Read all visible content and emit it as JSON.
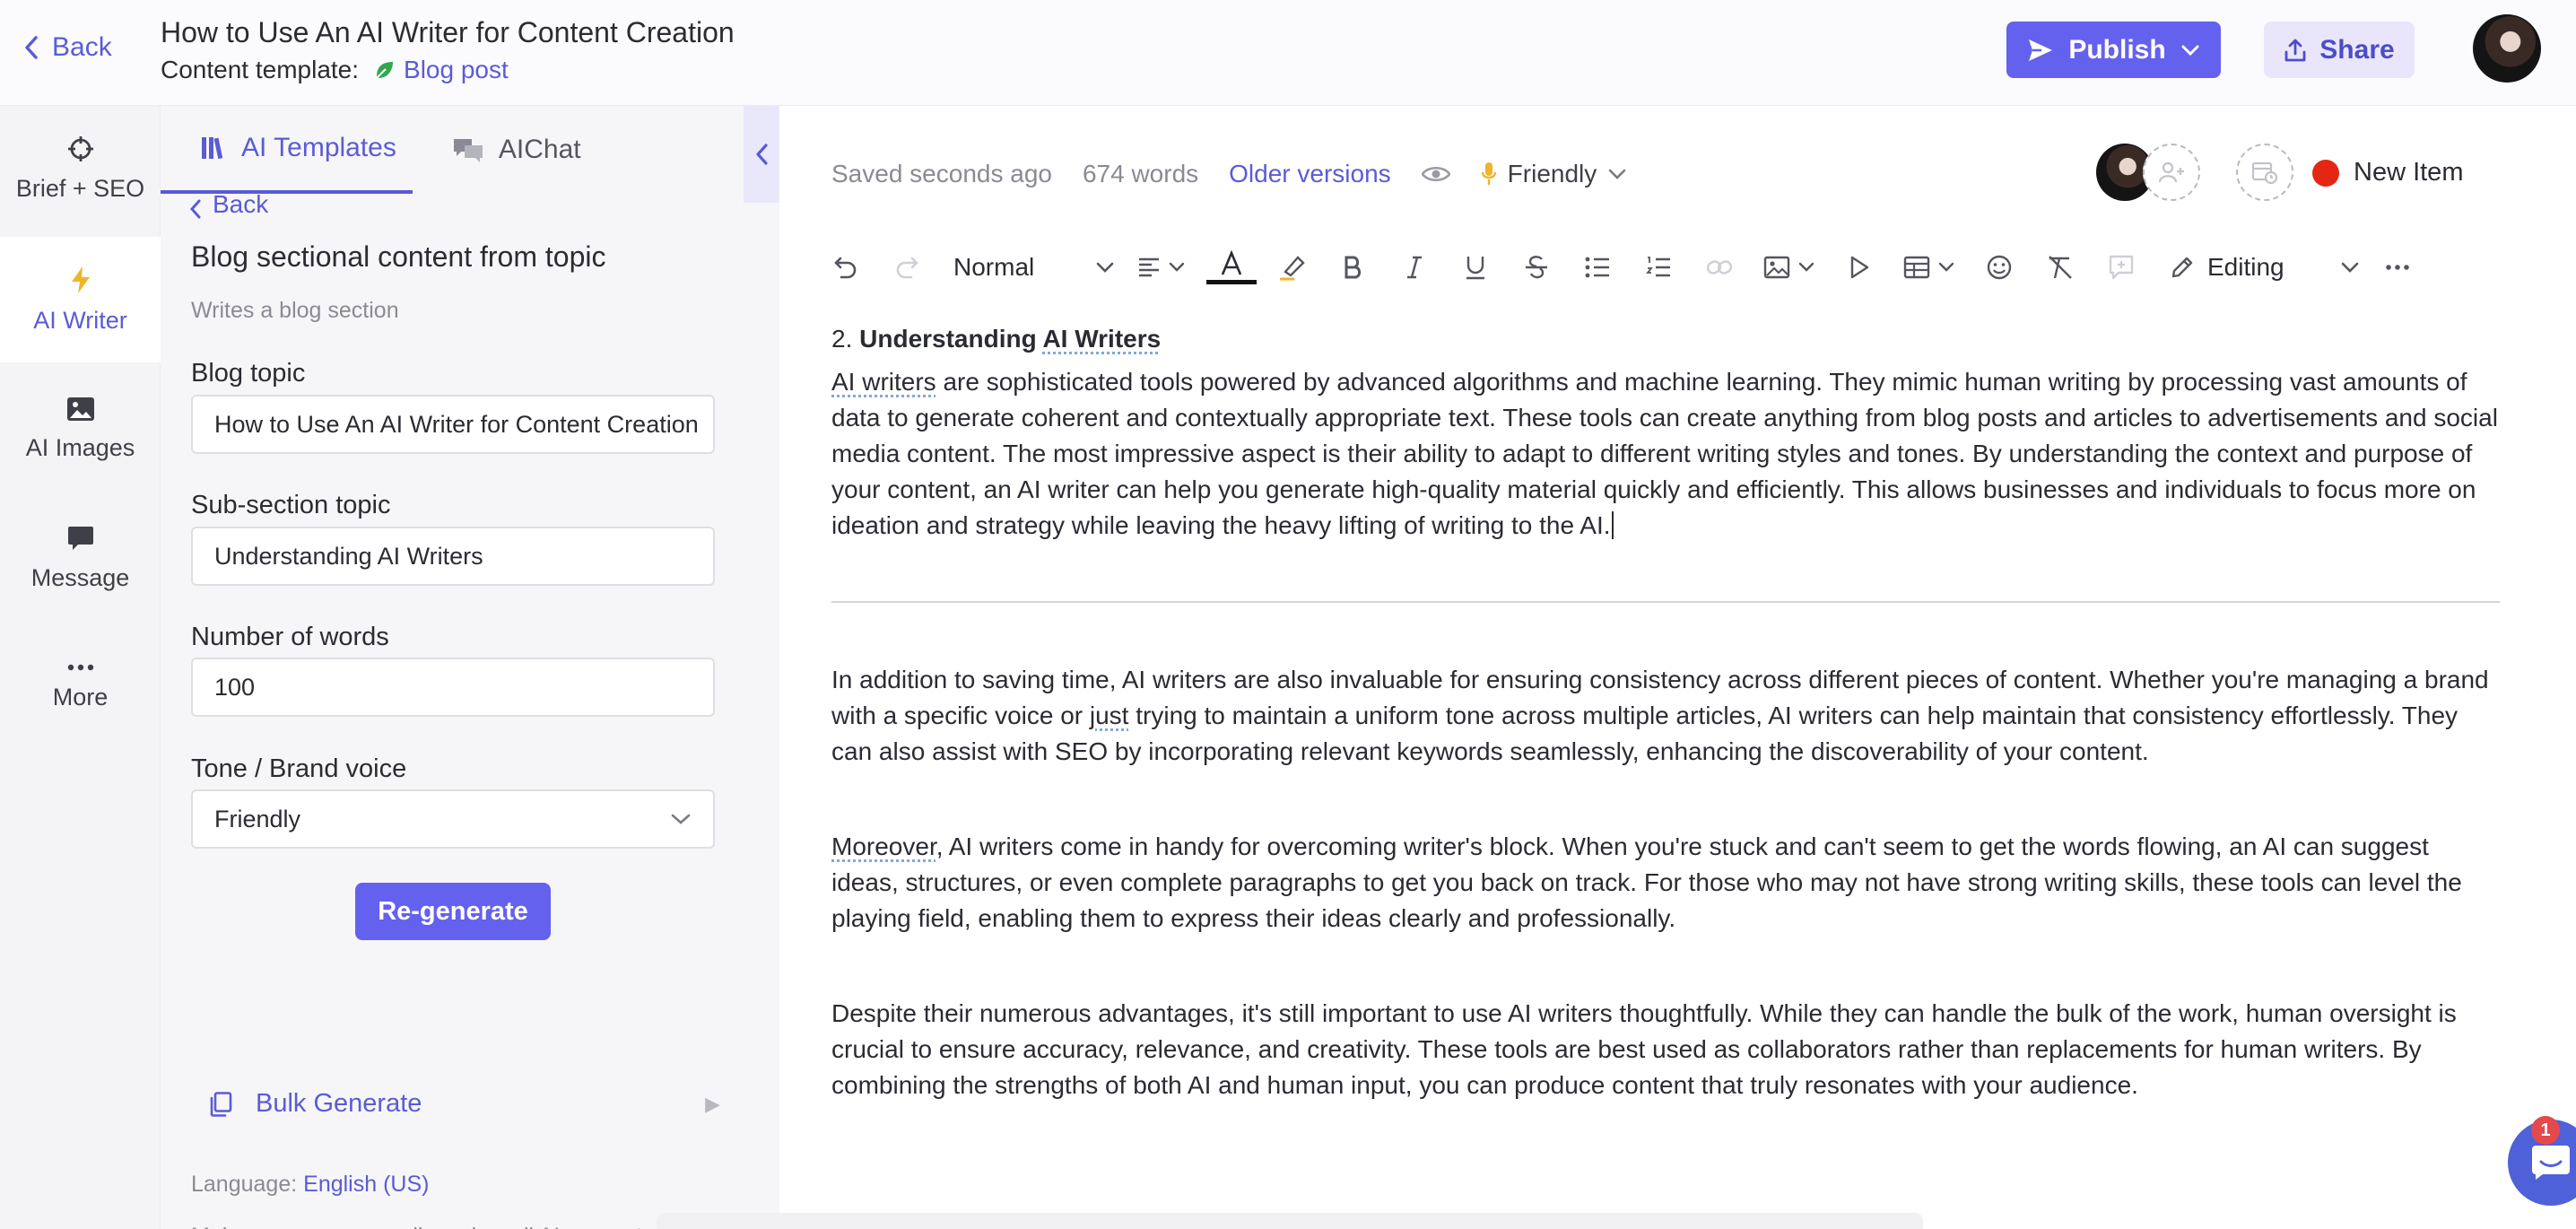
{
  "header": {
    "back_label": "Back",
    "title": "How to Use An AI Writer for Content Creation",
    "template_label": "Content template:",
    "template_value": "Blog post",
    "publish_label": "Publish",
    "share_label": "Share"
  },
  "rail": {
    "items": [
      {
        "label": "Brief + SEO",
        "icon": "crosshair-icon"
      },
      {
        "label": "AI Writer",
        "icon": "lightning-icon"
      },
      {
        "label": "AI Images",
        "icon": "image-icon"
      },
      {
        "label": "Message",
        "icon": "chat-bubble-icon"
      },
      {
        "label": "More",
        "icon": "dots-icon"
      }
    ]
  },
  "panel": {
    "tabs": [
      {
        "label": "AI Templates",
        "icon": "library-icon"
      },
      {
        "label": "AIChat",
        "icon": "chat-icon"
      }
    ],
    "back_label": "Back",
    "section_title": "Blog sectional content from topic",
    "section_subtitle": "Writes a blog section",
    "fields": {
      "blog_topic": {
        "label": "Blog topic",
        "value": "How to Use An AI Writer for Content Creation"
      },
      "subsection_topic": {
        "label": "Sub-section topic",
        "value": "Understanding AI Writers"
      },
      "num_words": {
        "label": "Number of words",
        "value": "100"
      },
      "tone": {
        "label": "Tone / Brand voice",
        "value": "Friendly"
      }
    },
    "regenerate_label": "Re-generate",
    "bulk_label": "Bulk Generate",
    "language_label": "Language:",
    "language_value": "English (US)",
    "disclaimer": "Make sure you manually review all AI generated text."
  },
  "editor": {
    "status": {
      "saved": "Saved seconds ago",
      "words": "674 words",
      "older_versions": "Older versions",
      "tone": "Friendly"
    },
    "new_item_label": "New Item",
    "toolbar": {
      "style_value": "Normal",
      "mode_value": "Editing"
    },
    "heading_number": "2.",
    "heading_text": "Understanding ",
    "heading_text_marked": "AI Writers",
    "p1_marked": "AI writers",
    "p1_rest": " are sophisticated tools powered by advanced algorithms and machine learning. They mimic human writing by processing vast amounts of data to generate coherent and contextually appropriate text. These tools can create anything from blog posts and articles to advertisements and social media content. The most impressive aspect is their ability to adapt to different writing styles and tones. By understanding the context and purpose of your content, an AI writer can help you generate high-quality material quickly and efficiently. This allows businesses and individuals to focus more on ideation and strategy while leaving the heavy lifting of writing to the AI.",
    "p2_a": "In addition to saving time, AI writers are also invaluable for ensuring consistency across different pieces of content. Whether you're managing a brand with a specific voice or ",
    "p2_marked": "just",
    "p2_b": " trying to maintain a uniform tone across multiple articles, AI writers can help maintain that consistency effortlessly. They can also assist with SEO by incorporating relevant keywords seamlessly, enhancing the discoverability of your content.",
    "p3_marked": "Moreover",
    "p3_rest": ", AI writers come in handy for overcoming writer's block. When you're stuck and can't seem to get the words flowing, an AI can suggest ideas, structures, or even complete paragraphs to get you back on track. For those who may not have strong writing skills, these tools can level the playing field, enabling them to express their ideas clearly and professionally.",
    "p4": "Despite their numerous advantages, it's still important to use AI writers thoughtfully. While they can handle the bulk of the work, human oversight is crucial to ensure accuracy, relevance, and creativity. These tools are best used as collaborators rather than replacements for human writers. By combining the strengths of both AI and human input, you can produce content that truly resonates with your audience."
  },
  "chat_widget": {
    "badge_count": "1"
  },
  "colors": {
    "accent": "#6461ee",
    "accent_text": "#5b5bd6",
    "new_item_dot": "#e52614"
  }
}
